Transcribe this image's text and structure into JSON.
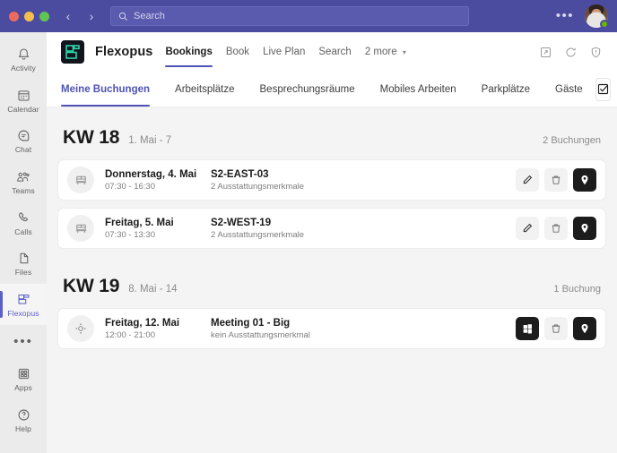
{
  "titlebar": {
    "window_controls": [
      "close",
      "minimize",
      "maximize"
    ],
    "back_label": "‹",
    "forward_label": "›",
    "search": {
      "placeholder": "Search",
      "value": "",
      "icon": "search-icon"
    },
    "more_label": "•••",
    "presence": "available",
    "accent_color": "#4b4ba0"
  },
  "rail": {
    "items": [
      {
        "label": "Activity",
        "icon": "bell-icon",
        "active": false
      },
      {
        "label": "Calendar",
        "icon": "calendar-icon",
        "active": false
      },
      {
        "label": "Chat",
        "icon": "chat-icon",
        "active": false
      },
      {
        "label": "Teams",
        "icon": "teams-icon",
        "active": false
      },
      {
        "label": "Calls",
        "icon": "phone-icon",
        "active": false
      },
      {
        "label": "Files",
        "icon": "file-icon",
        "active": false
      },
      {
        "label": "Flexopus",
        "icon": "flexopus-icon",
        "active": true
      }
    ],
    "more_label": "•••",
    "apps": {
      "label": "Apps",
      "icon": "apps-grid-icon"
    },
    "help": {
      "label": "Help",
      "icon": "question-circle-icon"
    },
    "active_color": "#5b5fc7"
  },
  "app_header": {
    "logo_icon": "flexopus-logo-icon",
    "title": "Flexopus",
    "tabs": [
      {
        "label": "Bookings",
        "active": true
      },
      {
        "label": "Book",
        "active": false
      },
      {
        "label": "Live Plan",
        "active": false
      },
      {
        "label": "Search",
        "active": false
      },
      {
        "label": "2 more",
        "active": false,
        "has_caret": true
      }
    ],
    "right_icons": [
      {
        "name": "open-in-new-window-icon"
      },
      {
        "name": "refresh-icon"
      },
      {
        "name": "shield-icon"
      }
    ],
    "accent_color": "#4f52b5"
  },
  "nav_tabs": {
    "items": [
      {
        "label": "Meine Buchungen",
        "active": true
      },
      {
        "label": "Arbeitsplätze",
        "active": false
      },
      {
        "label": "Besprechungsräume",
        "active": false
      },
      {
        "label": "Mobiles Arbeiten",
        "active": false
      },
      {
        "label": "Parkplätze",
        "active": false
      },
      {
        "label": "Gäste",
        "active": false
      }
    ],
    "checkbox_button": {
      "name": "select-mode-button",
      "icon": "checkbox-checked-icon"
    }
  },
  "weeks": [
    {
      "kw": "KW 18",
      "range": "1. Mai - 7",
      "count": "2 Buchungen",
      "bookings": [
        {
          "icon": "desk-icon",
          "day": "Donnerstag, 4. Mai",
          "time": "07:30 - 16:30",
          "resource": "S2-EAST-03",
          "features": "2 Ausstattungsmerkmale",
          "actions": [
            {
              "name": "edit-booking-button",
              "icon": "pencil-icon",
              "style": "light"
            },
            {
              "name": "delete-booking-button",
              "icon": "trash-icon",
              "style": "light"
            },
            {
              "name": "show-location-button",
              "icon": "location-pin-icon",
              "style": "dark"
            }
          ]
        },
        {
          "icon": "desk-icon",
          "day": "Freitag, 5. Mai",
          "time": "07:30 - 13:30",
          "resource": "S2-WEST-19",
          "features": "2 Ausstattungsmerkmale",
          "actions": [
            {
              "name": "edit-booking-button",
              "icon": "pencil-icon",
              "style": "light"
            },
            {
              "name": "delete-booking-button",
              "icon": "trash-icon",
              "style": "light"
            },
            {
              "name": "show-location-button",
              "icon": "location-pin-icon",
              "style": "dark"
            }
          ]
        }
      ]
    },
    {
      "kw": "KW 19",
      "range": "8. Mai - 14",
      "count": "1 Buchung",
      "bookings": [
        {
          "icon": "meeting-room-icon",
          "day": "Freitag, 12. Mai",
          "time": "12:00 - 21:00",
          "resource": "Meeting 01 - Big",
          "features": "kein Ausstattungsmerkmal",
          "actions": [
            {
              "name": "open-in-teams-button",
              "icon": "windows-logo-icon",
              "style": "dark"
            },
            {
              "name": "delete-booking-button",
              "icon": "trash-icon",
              "style": "light"
            },
            {
              "name": "show-location-button",
              "icon": "location-pin-icon",
              "style": "dark"
            }
          ]
        }
      ]
    }
  ]
}
